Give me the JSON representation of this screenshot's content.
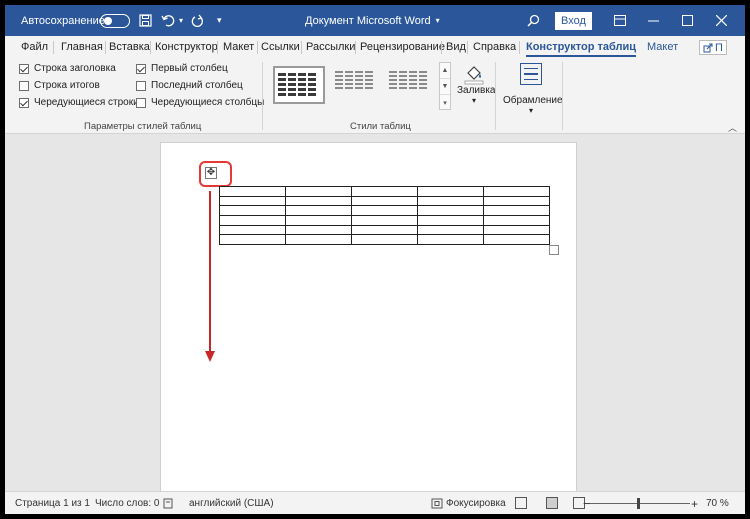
{
  "titlebar": {
    "autosave_label": "Автосохранение",
    "document_title": "Документ Microsoft Word",
    "login_button": "Вход"
  },
  "tabs": [
    {
      "label": "Файл"
    },
    {
      "label": "Главная"
    },
    {
      "label": "Вставка"
    },
    {
      "label": "Конструктор"
    },
    {
      "label": "Макет"
    },
    {
      "label": "Ссылки"
    },
    {
      "label": "Рассылки"
    },
    {
      "label": "Рецензирование"
    },
    {
      "label": "Вид"
    },
    {
      "label": "Справка"
    },
    {
      "label": "Конструктор таблиц"
    },
    {
      "label": "Макет"
    }
  ],
  "ribbon": {
    "options_group": {
      "label": "Параметры стилей таблиц",
      "options": [
        {
          "label": "Строка заголовка",
          "checked": true
        },
        {
          "label": "Строка итогов",
          "checked": false
        },
        {
          "label": "Чередующиеся строки",
          "checked": true
        },
        {
          "label": "Первый столбец",
          "checked": true
        },
        {
          "label": "Последний столбец",
          "checked": false
        },
        {
          "label": "Чередующиеся столбцы",
          "checked": false
        }
      ]
    },
    "styles_group": {
      "label": "Стили таблиц"
    },
    "fill_label": "Заливка",
    "border_label": "Обрамление"
  },
  "status": {
    "page": "Страница 1 из 1",
    "words": "Число слов: 0",
    "language": "английский (США)",
    "focus": "Фокусировка",
    "zoom": "70 %"
  },
  "table": {
    "rows": 6,
    "cols": 5
  },
  "colors": {
    "title_bar": "#2b579a",
    "highlight": "#e53935",
    "arrow": "#c62828"
  }
}
